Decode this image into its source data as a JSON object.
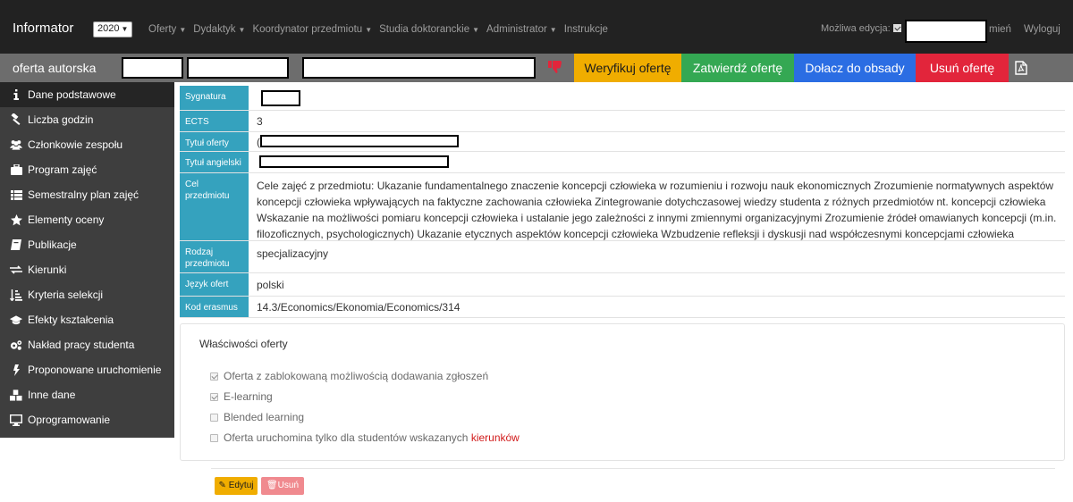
{
  "navbar": {
    "brand": "Informator",
    "year": "2020",
    "menu": [
      "Oferty",
      "Dydaktyk",
      "Koordynator przedmiotu",
      "Studia doktoranckie",
      "Administrator",
      "Instrukcje"
    ],
    "edit_label": "Możliwa edycja:",
    "change_link": "mień",
    "logout": "Wyloguj"
  },
  "titlebar": {
    "title": "oferta autorska",
    "verify": "Weryfikuj ofertę",
    "approve": "Zatwierdź ofertę",
    "join": "Dołacz do obsady",
    "delete": "Usuń ofertę"
  },
  "sidebar": {
    "items": [
      {
        "label": "Dane podstawowe",
        "icon": "info-icon"
      },
      {
        "label": "Liczba godzin",
        "icon": "gavel-icon"
      },
      {
        "label": "Członkowie zespołu",
        "icon": "users-icon"
      },
      {
        "label": "Program zajęć",
        "icon": "briefcase-icon"
      },
      {
        "label": "Semestralny plan zajęć",
        "icon": "list-icon"
      },
      {
        "label": "Elementy oceny",
        "icon": "star-icon"
      },
      {
        "label": "Publikacje",
        "icon": "book-icon"
      },
      {
        "label": "Kierunki",
        "icon": "exchange-icon"
      },
      {
        "label": "Kryteria selekcji",
        "icon": "sort-icon"
      },
      {
        "label": "Efekty kształcenia",
        "icon": "graduation-cap-icon"
      },
      {
        "label": "Nakład pracy studenta",
        "icon": "cogs-icon"
      },
      {
        "label": "Proponowane uruchomienie",
        "icon": "bolt-icon"
      },
      {
        "label": "Inne dane",
        "icon": "cubes-icon"
      },
      {
        "label": "Oprogramowanie",
        "icon": "desktop-icon"
      }
    ]
  },
  "details": {
    "signature_label": "Sygnatura",
    "ects_label": "ECTS",
    "ects_value": "3",
    "title_label": "Tytuł oferty",
    "title_prefix": "(",
    "title_en_label": "Tytuł angielski",
    "goal_label": "Cel przedmiotu",
    "goal_value": "Cele zajęć z przedmiotu: Ukazanie fundamentalnego znaczenie koncepcji człowieka w rozumieniu i rozwoju nauk ekonomicznych Zrozumienie normatywnych aspektów koncepcji człowieka wpływających na faktyczne zachowania człowieka Zintegrowanie dotychczasowej wiedzy studenta z różnych przedmiotów nt. koncepcji człowieka Wskazanie na możliwości pomiaru koncepcji człowieka i ustalanie jego zależności z innymi zmiennymi organizacyjnymi Zrozumienie źródeł omawianych koncepcji (m.in. filozoficznych, psychologicznych) Ukazanie etycznych aspektów koncepcji człowieka Wzbudzenie refleksji i dyskusji nad współczesnymi koncepcjami człowieka",
    "type_label": "Rodzaj przedmiotu",
    "type_value": "specjalizacyjny",
    "lang_label": "Język ofert",
    "lang_value": "polski",
    "erasmus_label": "Kod erasmus",
    "erasmus_value": "14.3/Economics/Ekonomia/Economics/314"
  },
  "properties": {
    "title": "Właściwości oferty",
    "items": [
      {
        "label": "Oferta z zablokowaną możliwością dodawania zgłoszeń",
        "checked": true
      },
      {
        "label": "E-learning",
        "checked": true
      },
      {
        "label": "Blended learning",
        "checked": false
      },
      {
        "label": "Oferta uruchomina tylko dla studentów wskazanych ",
        "link": "kierunków",
        "checked": false
      }
    ]
  },
  "footer": {
    "edit": "Edytuj",
    "delete": "Usuń"
  },
  "colors": {
    "navbar": "#222222",
    "titlebar": "#6d6d6d",
    "sidebar": "#3e3e3e",
    "label_cell": "#35a2be",
    "verify": "#f0ad00",
    "approve": "#34a853",
    "join": "#2b6de3",
    "delete": "#e2253b"
  }
}
